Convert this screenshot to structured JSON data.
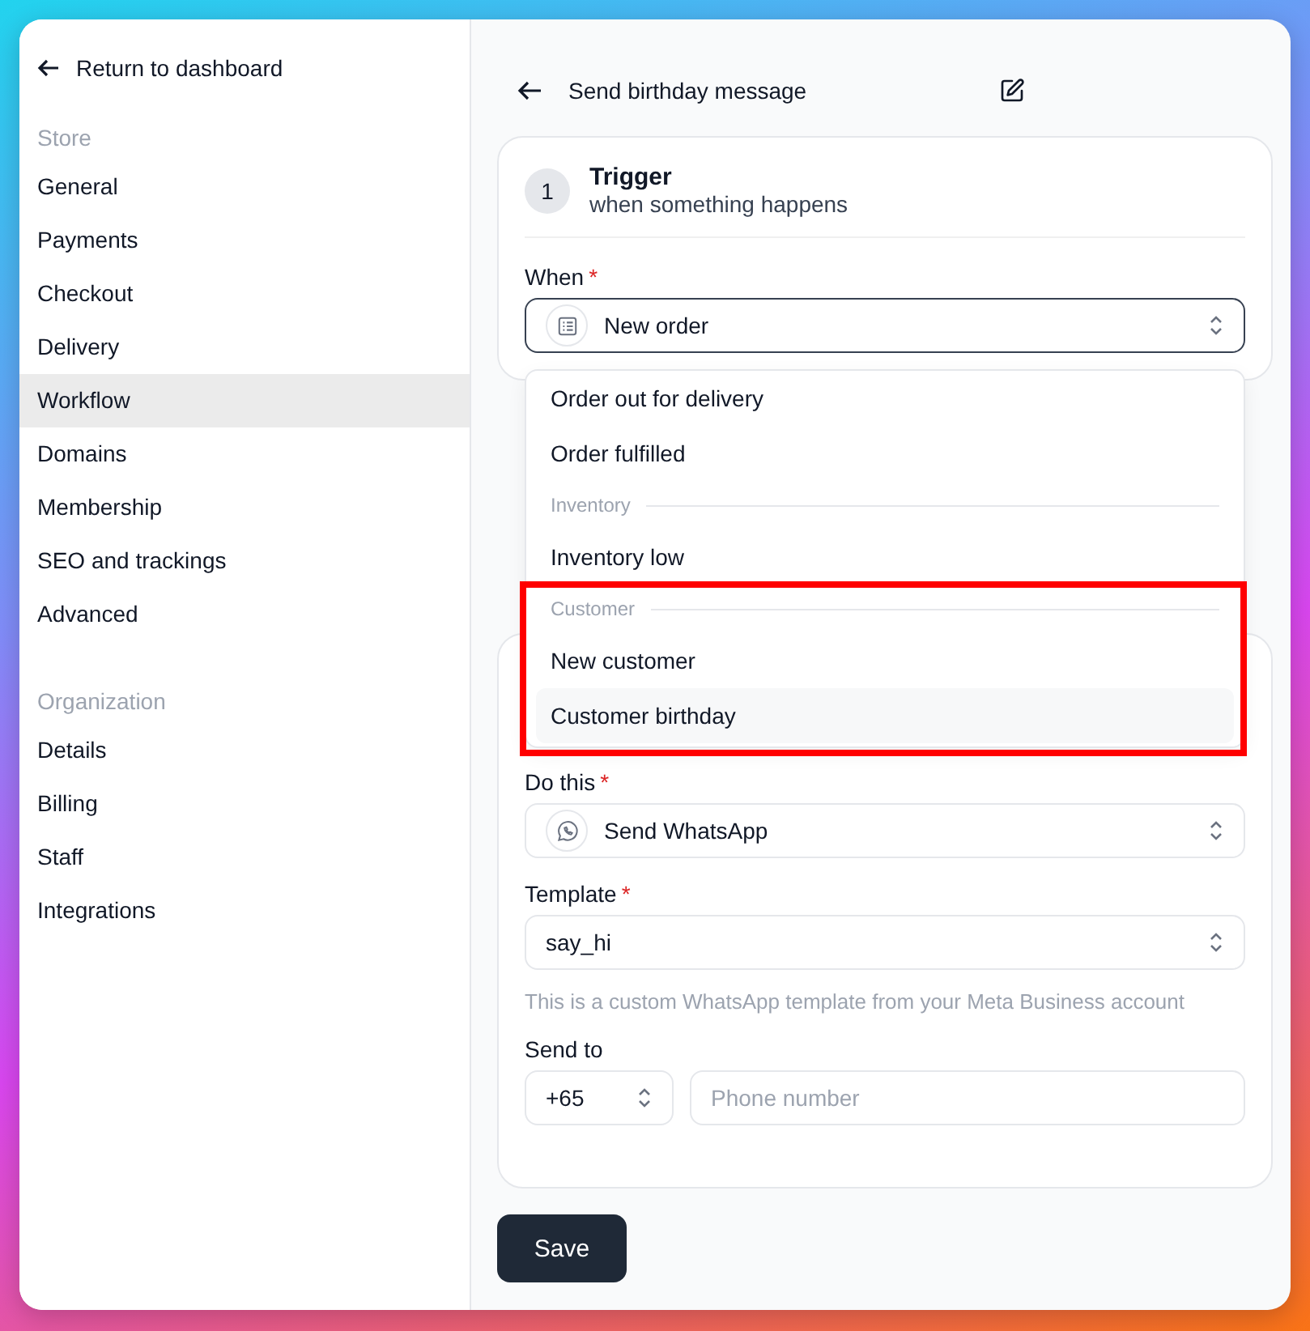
{
  "sidebar": {
    "back_link": "Return to dashboard",
    "sections": [
      {
        "title": "Store",
        "items": [
          {
            "label": "General",
            "selected": false
          },
          {
            "label": "Payments",
            "selected": false
          },
          {
            "label": "Checkout",
            "selected": false
          },
          {
            "label": "Delivery",
            "selected": false
          },
          {
            "label": "Workflow",
            "selected": true
          },
          {
            "label": "Domains",
            "selected": false
          },
          {
            "label": "Membership",
            "selected": false
          },
          {
            "label": "SEO and trackings",
            "selected": false
          },
          {
            "label": "Advanced",
            "selected": false
          }
        ]
      },
      {
        "title": "Organization",
        "items": [
          {
            "label": "Details",
            "selected": false
          },
          {
            "label": "Billing",
            "selected": false
          },
          {
            "label": "Staff",
            "selected": false
          },
          {
            "label": "Integrations",
            "selected": false
          }
        ]
      }
    ]
  },
  "header": {
    "title": "Send birthday message"
  },
  "trigger": {
    "step": "1",
    "title": "Trigger",
    "subtitle": "when something happens",
    "field": {
      "label": "When",
      "required_mark": "*",
      "value": "New order",
      "expanded": true
    }
  },
  "dropdown": [
    {
      "kind": "option",
      "label": "Order out for delivery",
      "highlighted": false
    },
    {
      "kind": "option",
      "label": "Order fulfilled",
      "highlighted": false
    },
    {
      "kind": "heading",
      "label": "Inventory"
    },
    {
      "kind": "option",
      "label": "Inventory low",
      "highlighted": false
    },
    {
      "kind": "heading",
      "label": "Customer"
    },
    {
      "kind": "option",
      "label": "New customer",
      "highlighted": false
    },
    {
      "kind": "option",
      "label": "Customer birthday",
      "highlighted": true
    }
  ],
  "action": {
    "do_this": {
      "label": "Do this",
      "required_mark": "*",
      "value": "Send WhatsApp"
    },
    "template": {
      "label": "Template",
      "required_mark": "*",
      "value": "say_hi",
      "hint": "This is a custom WhatsApp template from your Meta Business account"
    },
    "send_to": {
      "label": "Send to",
      "country_code": "+65",
      "placeholder": "Phone number"
    }
  },
  "save_button": "Save"
}
